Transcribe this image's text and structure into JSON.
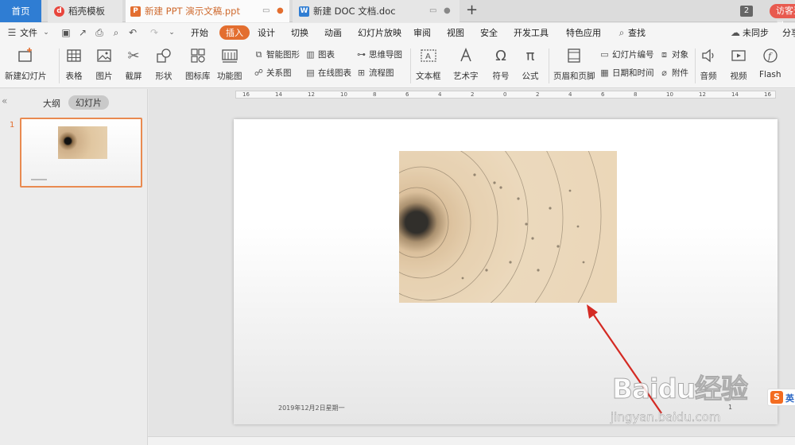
{
  "tabs": {
    "home": "首页",
    "templates": "稻壳模板",
    "ppt": "新建 PPT 演示文稿.ppt",
    "doc": "新建 DOC 文档.doc",
    "window_count": "2",
    "visitor": "访客登录"
  },
  "menu": {
    "file": "文件",
    "items": [
      "开始",
      "插入",
      "设计",
      "切换",
      "动画",
      "幻灯片放映",
      "审阅",
      "视图",
      "安全",
      "开发工具",
      "特色应用"
    ],
    "search": "查找",
    "sync": "未同步",
    "share": "分享"
  },
  "ribbon": {
    "new_slide": "新建幻灯片",
    "table": "表格",
    "picture": "图片",
    "screenshot": "截屏",
    "shapes": "形状",
    "icon_library": "图标库",
    "function_chart": "功能图",
    "smart_art": "智能图形",
    "chart": "图表",
    "mind_map": "思维导图",
    "relation_chart": "关系图",
    "online_chart": "在线图表",
    "flowchart": "流程图",
    "textbox": "文本框",
    "word_art": "艺术字",
    "symbol": "符号",
    "formula": "公式",
    "header_footer": "页眉和页脚",
    "slide_number": "幻灯片编号",
    "object": "对象",
    "date_time": "日期和时间",
    "attachment": "附件",
    "audio": "音频",
    "video": "视频",
    "flash": "Flash"
  },
  "panel": {
    "outline": "大纲",
    "slides": "幻灯片",
    "slide_number": "1"
  },
  "ruler": [
    "16",
    "14",
    "12",
    "10",
    "8",
    "6",
    "4",
    "2",
    "0",
    "2",
    "4",
    "6",
    "8",
    "10",
    "12",
    "14",
    "16"
  ],
  "slide": {
    "date": "2019年12月2日星期一",
    "page": "1"
  },
  "watermark": {
    "url": "jingyan.baidu.com",
    "logo": "Baidu经验",
    "badge_text": "英"
  },
  "colors": {
    "accent": "#e36e2f",
    "home_tab": "#2f7dd3",
    "arrow": "#d42a23"
  }
}
